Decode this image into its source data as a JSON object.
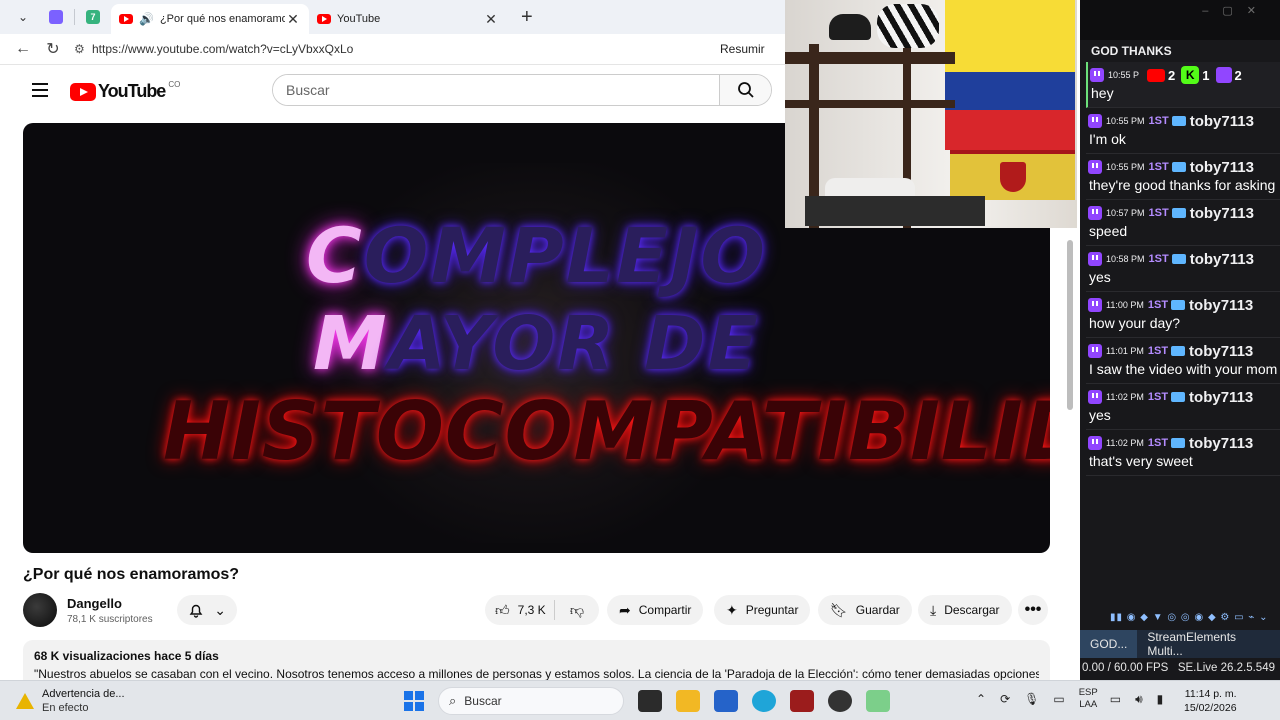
{
  "browser": {
    "tabs": [
      {
        "title": "¿Por qué nos enamoramos? -",
        "active": true
      },
      {
        "title": "YouTube",
        "active": false
      }
    ],
    "url": "https://www.youtube.com/watch?v=cLyVbxxQxLo",
    "resumir": "Resumir"
  },
  "youtube": {
    "logo_text": "YouTube",
    "country": "CO",
    "search_placeholder": "Buscar",
    "thumbnail": {
      "line1_hi": "C",
      "line1_lo": "OMPLEJO",
      "line2_hi": "M",
      "line2_lo": "AYOR DE",
      "line3": "HISTOCOMPATIBILIDA"
    },
    "video_title": "¿Por qué nos enamoramos?",
    "channel": {
      "name": "Dangello",
      "subscribers": "78,1 K suscriptores"
    },
    "actions": {
      "likes": "7,3 K",
      "share": "Compartir",
      "ask": "Preguntar",
      "save": "Guardar",
      "download": "Descargar"
    },
    "description": {
      "stats": "68 K visualizaciones  hace 5 días",
      "text": "\"Nuestros abuelos se casaban con el vecino. Nosotros tenemos acceso a millones de personas y estamos solos. La ciencia de la 'Paradoja de la Elección': cómo tener demasiadas opciones hace"
    }
  },
  "chat": {
    "title": "GOD THANKS",
    "header_counts": {
      "youtube": "2",
      "kick": "1",
      "twitch": "2"
    },
    "first_time": "10:55 P",
    "first_text": "hey",
    "messages": [
      {
        "time": "10:55 PM",
        "badge": "1ST",
        "user": "toby7113",
        "text": "I'm ok"
      },
      {
        "time": "10:55 PM",
        "badge": "1ST",
        "user": "toby7113",
        "text": "they're good thanks for asking"
      },
      {
        "time": "10:57 PM",
        "badge": "1ST",
        "user": "toby7113",
        "text": "speed"
      },
      {
        "time": "10:58 PM",
        "badge": "1ST",
        "user": "toby7113",
        "text": "yes"
      },
      {
        "time": "11:00 PM",
        "badge": "1ST",
        "user": "toby7113",
        "text": "how your day?"
      },
      {
        "time": "11:01 PM",
        "badge": "1ST",
        "user": "toby7113",
        "text": "I saw the video with your mom"
      },
      {
        "time": "11:02 PM",
        "badge": "1ST",
        "user": "toby7113",
        "text": "yes"
      },
      {
        "time": "11:02 PM",
        "badge": "1ST",
        "user": "toby7113",
        "text": "that's very sweet"
      }
    ],
    "bottom_tabs": [
      "GOD...",
      "StreamElements Multi..."
    ],
    "fps": "0.00 / 60.00 FPS",
    "version": "SE.Live 26.2.5.549"
  },
  "taskbar": {
    "notice_title": "Advertencia de...",
    "notice_sub": "En efecto",
    "search": "Buscar",
    "lang1": "ESP",
    "lang2": "LAA",
    "time": "11:14 p. m.",
    "date": "15/02/2026"
  },
  "colors": {
    "youtube_red": "#ff0000",
    "twitch_purple": "#9146ff",
    "kick_green": "#53fc18"
  }
}
